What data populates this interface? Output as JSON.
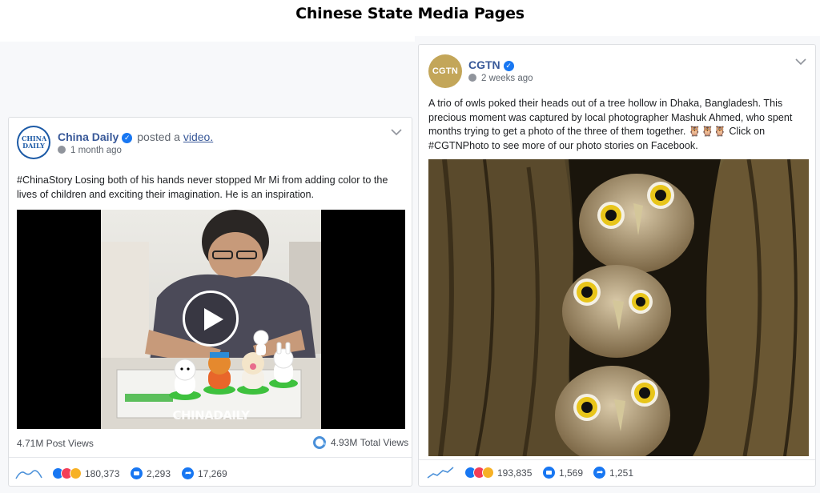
{
  "title": "Chinese State Media Pages",
  "left_post": {
    "page_name": "China Daily",
    "avatar_text": "CHINA DAILY",
    "posted_text": "posted a",
    "posted_link": "video.",
    "time": "1 month ago",
    "text": "#ChinaStory Losing both of his hands never stopped Mr Mi from adding color to the lives of children and exciting their imagination. He is an inspiration.",
    "watermark": "CHINADAILY",
    "post_views": "4.71M Post Views",
    "total_views_value": "4.93M",
    "total_views_label": "Total Views",
    "reactions": "180,373",
    "comments": "2,293",
    "shares": "17,269"
  },
  "right_post": {
    "page_name": "CGTN",
    "avatar_text": "CGTN",
    "time": "2 weeks ago",
    "text": "A trio of owls poked their heads out of a tree hollow in Dhaka, Bangladesh. This precious moment was captured by local photographer Mashuk Ahmed, who spent months trying to get a photo of the three of them together. 🦉🦉🦉 Click on #CGTNPhoto to see more of our photo stories on Facebook.",
    "reactions": "193,835",
    "comments": "1,569",
    "shares": "1,251"
  },
  "colors": {
    "link": "#385898",
    "fb_blue": "#1877f2",
    "china_daily_avatar": "#1c5aa6",
    "cgtn_avatar": "#c3a659"
  }
}
